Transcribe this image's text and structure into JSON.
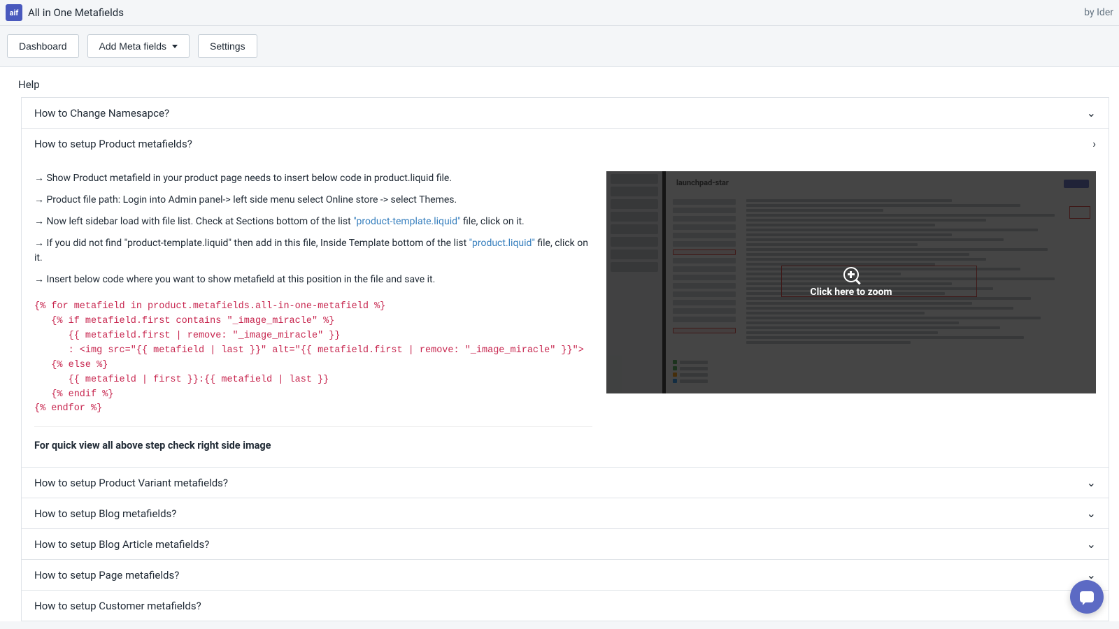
{
  "header": {
    "app_name": "All in One Metafields",
    "by_text": "by Ider"
  },
  "nav": {
    "dashboard": "Dashboard",
    "add_meta": "Add Meta fields",
    "settings": "Settings"
  },
  "page": {
    "title": "Help"
  },
  "accordion": {
    "item1": "How to Change Namesapce?",
    "item2": {
      "title": "How to setup Product metafields?",
      "step1_pre": "→ Show Product metafield in your product page needs to insert below code in product.liquid file.",
      "step2": "→ Product file path: Login into Admin panel-> left side menu select Online store -> select Themes.",
      "step3_a": "→ Now left sidebar load with file list. Check at Sections bottom of the list ",
      "step3_link": "\"product-template.liquid\"",
      "step3_b": " file, click on it.",
      "step4_a": "→ If you did not find \"product-template.liquid\" then add in this file, Inside Template bottom of the list ",
      "step4_link": "\"product.liquid\"",
      "step4_b": " file, click on it.",
      "step5": "→ Insert below code where you want to show metafield at this position in the file and save it.",
      "code": "{% for metafield in product.metafields.all-in-one-metafield %}\n   {% if metafield.first contains \"_image_miracle\" %}\n      {{ metafield.first | remove: \"_image_miracle\" }}\n      : <img src=\"{{ metafield | last }}\" alt=\"{{ metafield.first | remove: \"_image_miracle\" }}\">\n   {% else %}\n      {{ metafield | first }}:{{ metafield | last }}\n   {% endif %}\n{% endfor %}",
      "bold_note": "For quick view all above step check right side image",
      "zoom_text": "Click here to zoom",
      "img_title": "launchpad-star"
    },
    "item3": "How to setup Product Variant metafields?",
    "item4": "How to setup Blog metafields?",
    "item5": "How to setup Blog Article metafields?",
    "item6": "How to setup Page metafields?",
    "item7": "How to setup Customer metafields?"
  }
}
